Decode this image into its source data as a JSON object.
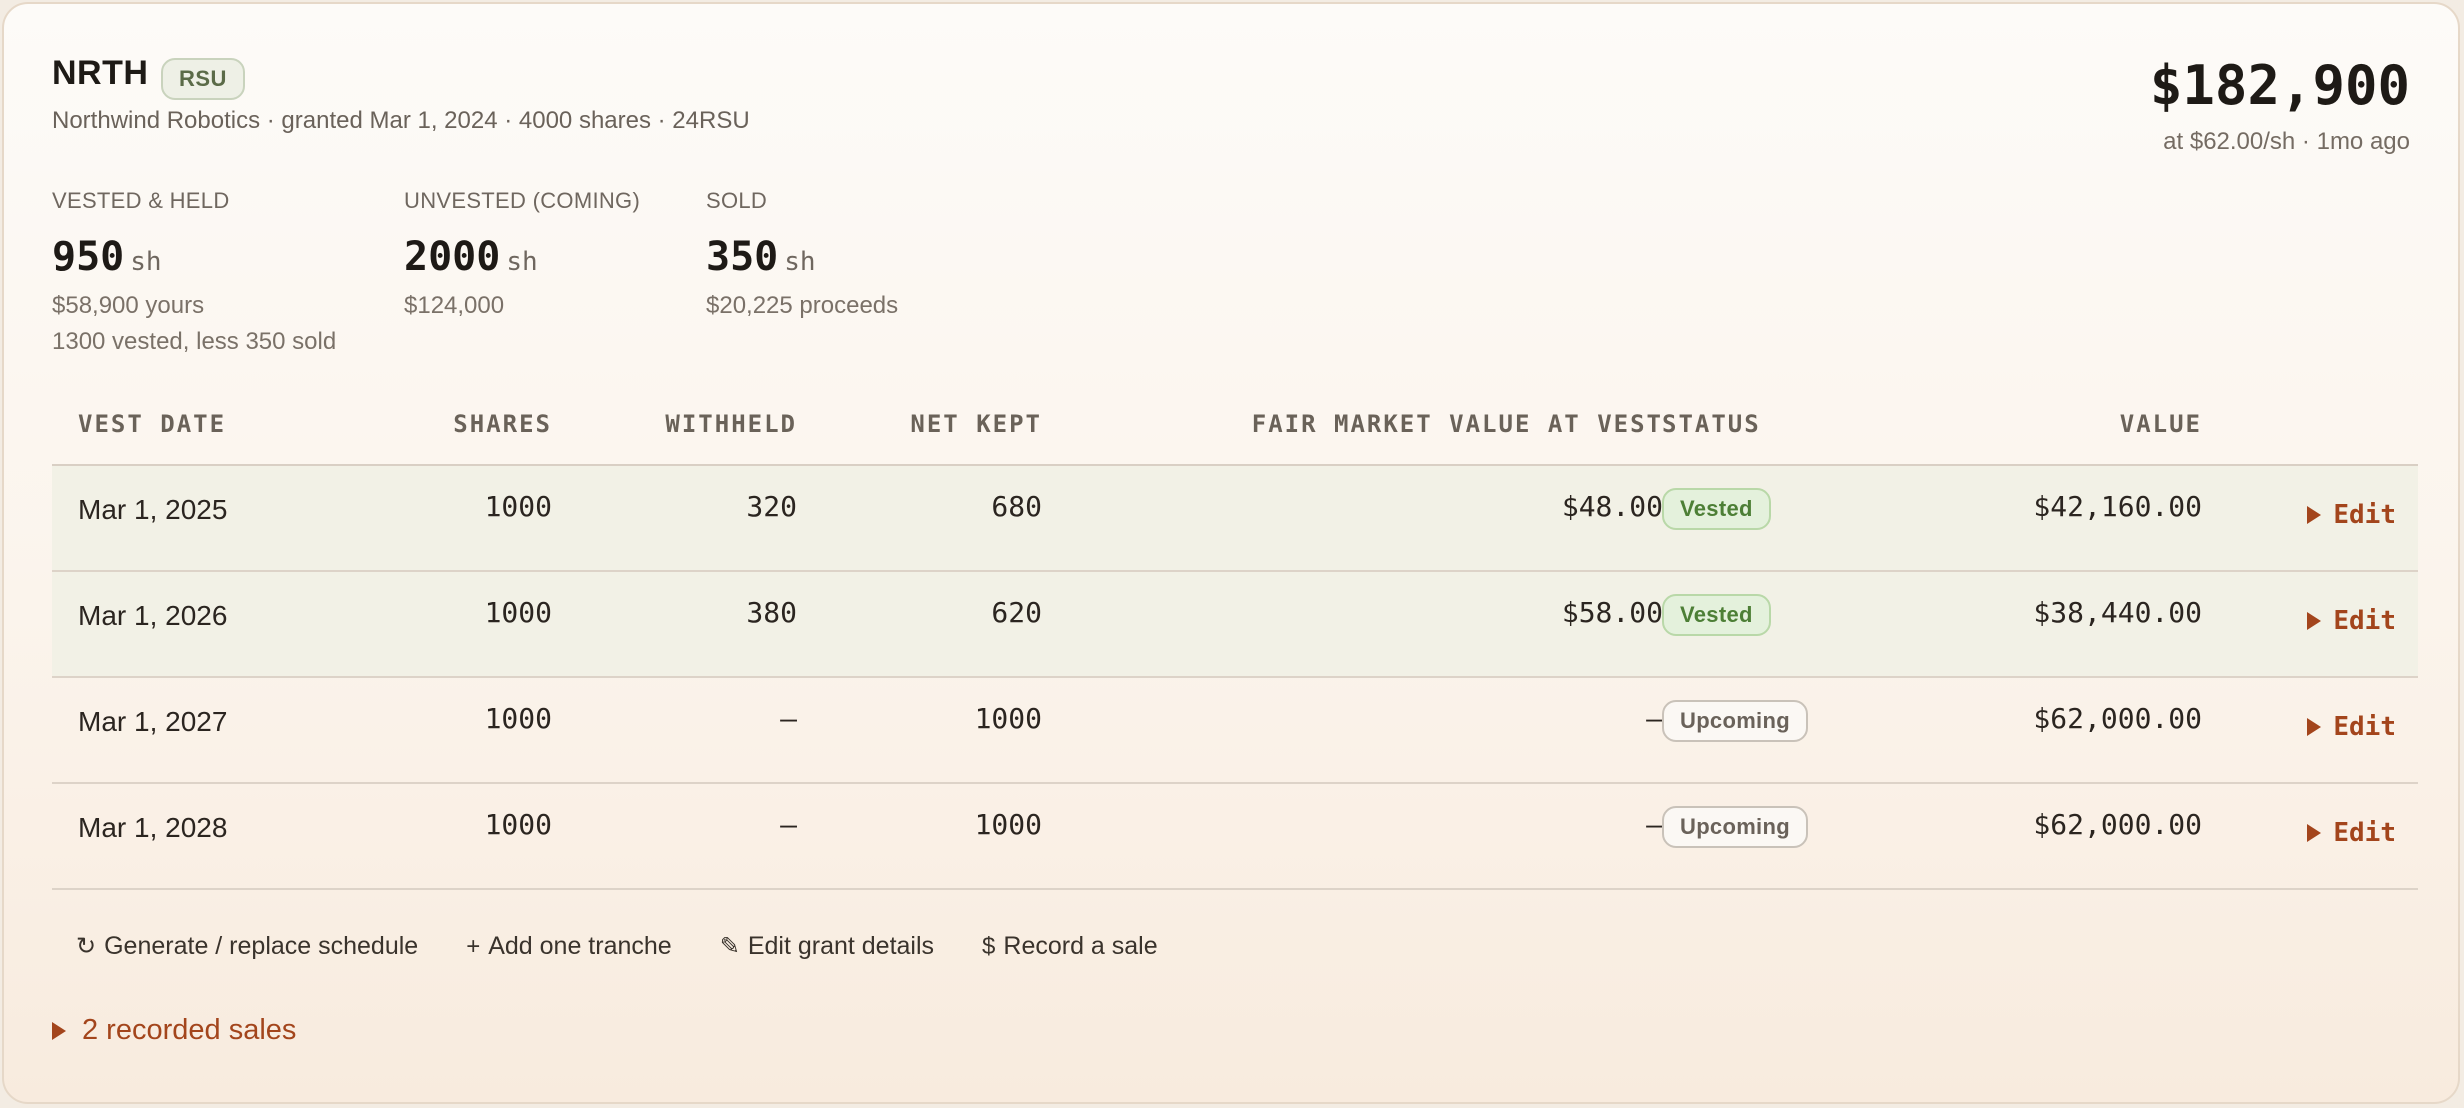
{
  "grant": {
    "ticker": "NRTH",
    "type": "RSU",
    "subtitle": "Northwind Robotics · granted Mar 1, 2024 · 4000 shares · 24RSU",
    "total_value": "$182,900",
    "price_note": "at $62.00/sh · 1mo ago"
  },
  "stats": {
    "held": {
      "label": "VESTED & HELD",
      "value": "950",
      "unit": "sh",
      "sub": "$58,900 yours",
      "sub2": "1300 vested, less 350 sold"
    },
    "unvested": {
      "label": "UNVESTED (COMING)",
      "value": "2000",
      "unit": "sh",
      "sub": "$124,000"
    },
    "sold": {
      "label": "SOLD",
      "value": "350",
      "unit": "sh",
      "sub": "$20,225 proceeds"
    }
  },
  "table": {
    "headers": {
      "date": "VEST DATE",
      "shares": "SHARES",
      "withheld": "WITHHELD",
      "net": "NET KEPT",
      "fmv": "FAIR MARKET VALUE AT VEST",
      "status": "STATUS",
      "value": "VALUE"
    },
    "rows": [
      {
        "date": "Mar 1, 2025",
        "shares": "1000",
        "withheld": "320",
        "net": "680",
        "fmv": "$48.00",
        "status": "Vested",
        "value": "$42,160.00",
        "action": "Edit"
      },
      {
        "date": "Mar 1, 2026",
        "shares": "1000",
        "withheld": "380",
        "net": "620",
        "fmv": "$58.00",
        "status": "Vested",
        "value": "$38,440.00",
        "action": "Edit"
      },
      {
        "date": "Mar 1, 2027",
        "shares": "1000",
        "withheld": "—",
        "net": "1000",
        "fmv": "—",
        "status": "Upcoming",
        "value": "$62,000.00",
        "action": "Edit"
      },
      {
        "date": "Mar 1, 2028",
        "shares": "1000",
        "withheld": "—",
        "net": "1000",
        "fmv": "—",
        "status": "Upcoming",
        "value": "$62,000.00",
        "action": "Edit"
      }
    ]
  },
  "actions": {
    "generate": {
      "icon": "↻",
      "label": "Generate / replace schedule"
    },
    "add": {
      "icon": "+",
      "label": "Add one tranche"
    },
    "edit": {
      "icon": "✎",
      "label": "Edit grant details"
    },
    "sale": {
      "icon": "$",
      "label": "Record a sale"
    }
  },
  "sales_toggle": "2 recorded sales",
  "colors": {
    "accent": "#a3451c",
    "vested_bg": "#e4f1dc",
    "vested_text": "#4d7f36"
  }
}
